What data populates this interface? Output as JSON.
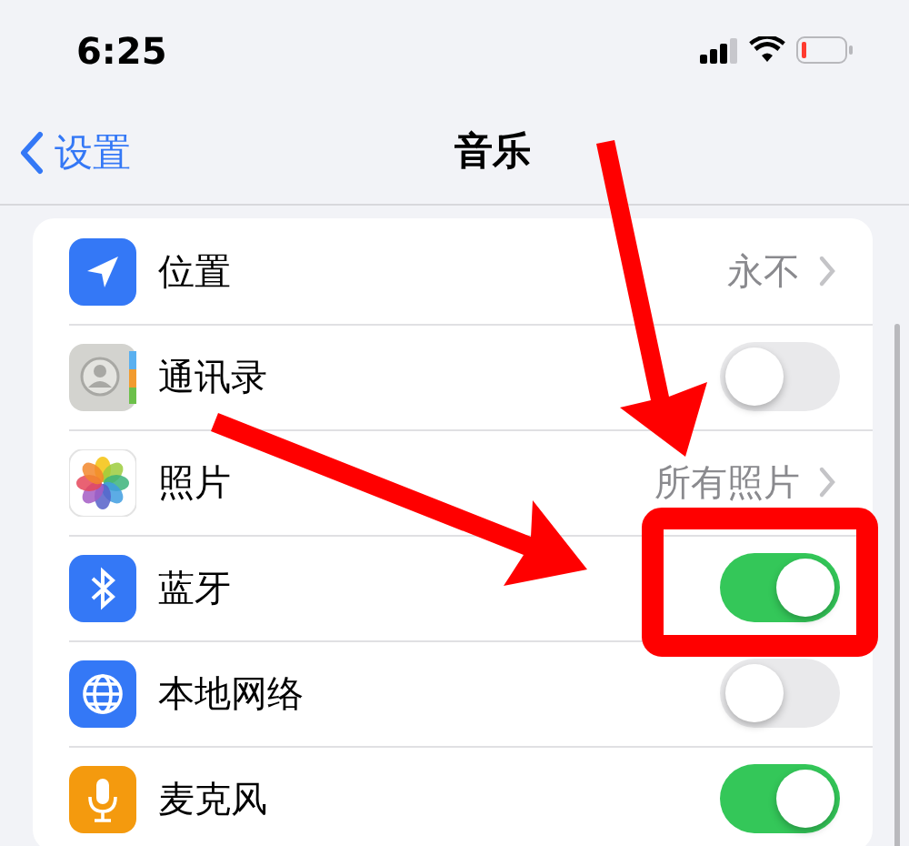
{
  "status_bar": {
    "time": "6:25"
  },
  "nav": {
    "back_label": "设置",
    "title": "音乐"
  },
  "rows": [
    {
      "label": "位置",
      "kind": "detail",
      "value": "永不"
    },
    {
      "label": "通讯录",
      "kind": "toggle",
      "on": false
    },
    {
      "label": "照片",
      "kind": "detail",
      "value": "所有照片"
    },
    {
      "label": "蓝牙",
      "kind": "toggle",
      "on": true
    },
    {
      "label": "本地网络",
      "kind": "toggle",
      "on": false
    },
    {
      "label": "麦克风",
      "kind": "toggle",
      "on": true
    }
  ],
  "annotations": [
    {
      "kind": "arrow"
    },
    {
      "kind": "arrow"
    },
    {
      "kind": "highlight_box"
    }
  ]
}
